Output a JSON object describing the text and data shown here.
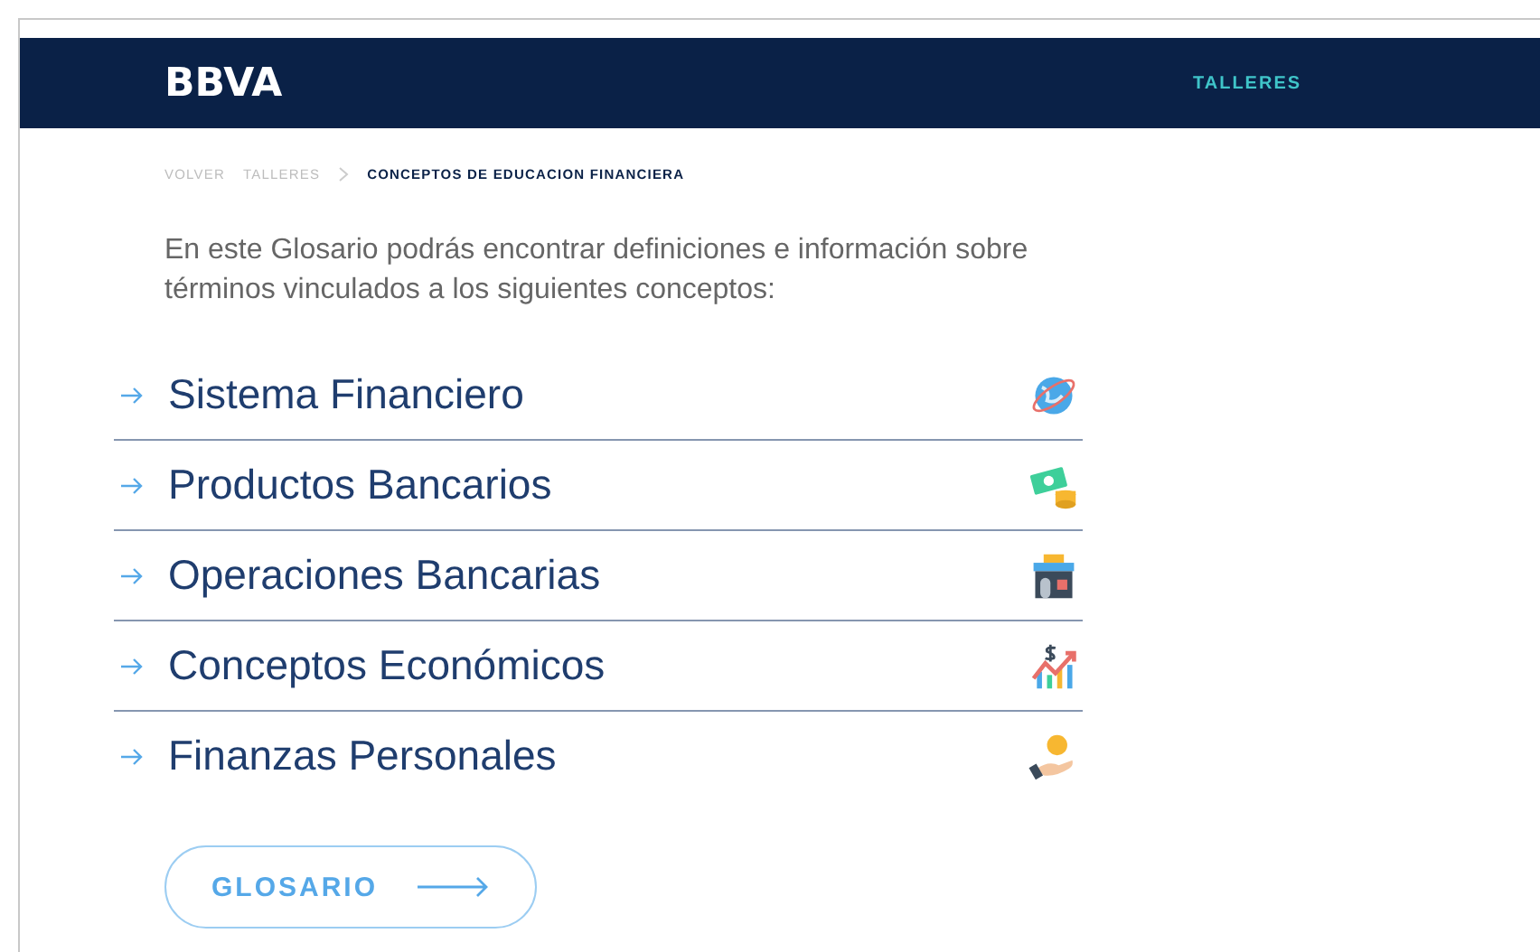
{
  "header": {
    "logo": "BBVA",
    "nav": [
      {
        "label": "TALLERES"
      }
    ]
  },
  "breadcrumb": [
    {
      "label": "VOLVER",
      "current": false
    },
    {
      "label": "TALLERES",
      "current": false
    },
    {
      "label": "CONCEPTOS DE EDUCACION FINANCIERA",
      "current": true
    }
  ],
  "intro": "En este Glosario podrás encontrar definiciones e información sobre términos vinculados a los siguientes conceptos:",
  "concepts": [
    {
      "label": "Sistema Financiero"
    },
    {
      "label": "Productos Bancarios"
    },
    {
      "label": "Operaciones Bancarias"
    },
    {
      "label": "Conceptos Económicos"
    },
    {
      "label": "Finanzas Personales"
    }
  ],
  "button": {
    "label": "GLOSARIO"
  }
}
